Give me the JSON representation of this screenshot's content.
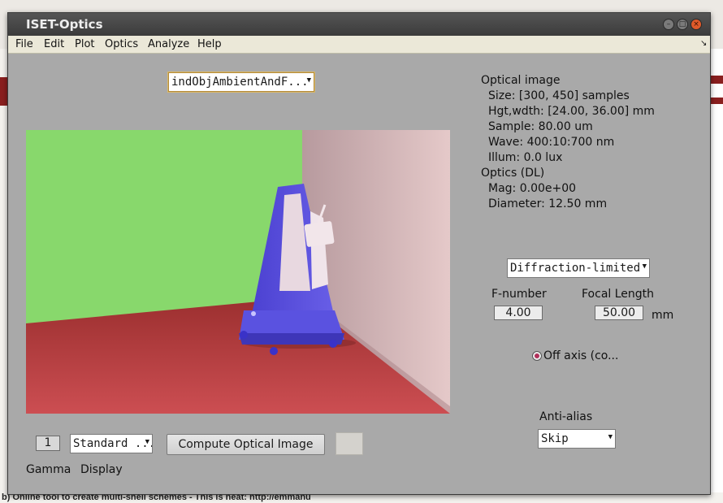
{
  "window": {
    "title": "ISET-Optics",
    "buttons": {
      "minimize": "–",
      "maximize": "□",
      "close": "×"
    }
  },
  "menu": {
    "items": [
      "File",
      "Edit",
      "Plot",
      "Optics",
      "Analyze",
      "Help"
    ],
    "corner": "↘"
  },
  "scene_select": {
    "value": "indObjAmbientAndF...",
    "arrow": "▼"
  },
  "optical_image": {
    "header": "Optical image",
    "size": "Size:  [300, 450] samples",
    "hgt_wdth": "Hgt,wdth: [24.00, 36.00] mm",
    "sample": "Sample: 80.00 um",
    "wave": "Wave: 400:10:700 nm",
    "illum": "Illum:   0.0 lux"
  },
  "optics_info": {
    "header": "Optics (DL)",
    "mag": "Mag:  0.00e+00",
    "diameter": "Diameter:  12.50 mm"
  },
  "optics_model": {
    "value": "Diffraction-limited",
    "arrow": "▼"
  },
  "fnumber": {
    "label": "F-number",
    "value": "4.00"
  },
  "focal_length": {
    "label": "Focal Length",
    "value": "50.00",
    "unit": "mm"
  },
  "off_axis": {
    "label": "Off axis (co...",
    "selected": true
  },
  "anti_alias": {
    "label": "Anti-alias",
    "value": "Skip",
    "arrow": "▼"
  },
  "gamma": {
    "label": "Gamma",
    "value": "1"
  },
  "display": {
    "label": "Display",
    "value": "Standard ...",
    "arrow": "▼"
  },
  "compute_button": {
    "label": "Compute Optical Image"
  },
  "background": {
    "status_line": "b) Online tool to create multi-shell schemes - This is neat: http://emmanu"
  },
  "colors": {
    "window_bg": "#a9a9a9",
    "titlebar": "#3b3b3b",
    "menubar": "#ebe8d8",
    "wall_green": "#88d86c",
    "floor_red": "#b23c3c",
    "metronome_blue": "#5549d8"
  }
}
